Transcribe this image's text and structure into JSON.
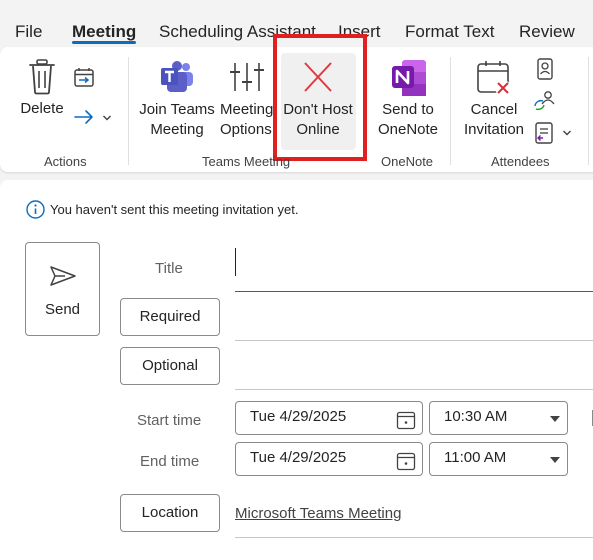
{
  "tabs": [
    {
      "label": "File"
    },
    {
      "label": "Meeting",
      "active": true
    },
    {
      "label": "Scheduling Assistant"
    },
    {
      "label": "Insert"
    },
    {
      "label": "Format Text"
    },
    {
      "label": "Review"
    }
  ],
  "ribbon": {
    "groups": {
      "actions": "Actions",
      "teams_meeting": "Teams Meeting",
      "onenote": "OneNote",
      "attendees": "Attendees"
    },
    "buttons": {
      "delete": "Delete",
      "join_teams_line1": "Join Teams",
      "join_teams_line2": "Meeting",
      "meeting_options_line1": "Meeting",
      "meeting_options_line2": "Options",
      "dont_host_line1": "Don't Host",
      "dont_host_line2": "Online",
      "send_onenote_line1": "Send to",
      "send_onenote_line2": "OneNote",
      "cancel_inv_line1": "Cancel",
      "cancel_inv_line2": "Invitation"
    }
  },
  "info": {
    "message": "You haven't sent this meeting invitation yet."
  },
  "form": {
    "send_label": "Send",
    "title_label": "Title",
    "title_value": "",
    "required_label": "Required",
    "optional_label": "Optional",
    "start_label": "Start time",
    "end_label": "End time",
    "start_date": "Tue 4/29/2025",
    "start_time": "10:30 AM",
    "end_date": "Tue 4/29/2025",
    "end_time": "11:00 AM",
    "location_label": "Location",
    "location_value": "Microsoft Teams Meeting"
  },
  "colors": {
    "accent": "#0f6cbd",
    "highlight_box": "#e02020",
    "teams_purple": "#5b5fc7",
    "onenote_purple": "#7719aa",
    "cancel_red": "#d13438"
  },
  "icons": {
    "delete": "trash-icon",
    "move": "calendar-arrow-icon",
    "forward": "arrow-right-icon",
    "teams": "teams-logo-icon",
    "meeting_options": "sliders-icon",
    "dont_host": "close-x-icon",
    "onenote": "onenote-logo-icon",
    "cancel": "calendar-cancel-icon",
    "address_book": "contact-card-icon",
    "response": "people-sync-icon",
    "check_names": "list-check-icon",
    "info": "info-icon",
    "send": "send-icon",
    "calendar": "calendar-icon",
    "dropdown": "caret-down-icon"
  }
}
